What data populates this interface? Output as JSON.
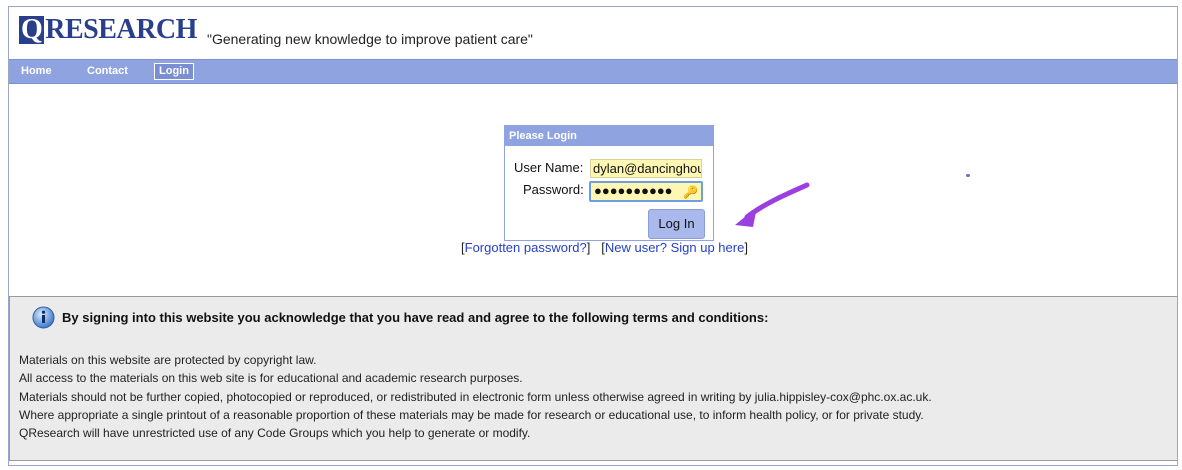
{
  "header": {
    "logo_letter": "Q",
    "logo_rest": "RESEARCH",
    "tagline": "\"Generating new knowledge to improve patient care\""
  },
  "nav": {
    "home": "Home",
    "contact": "Contact",
    "login": "Login"
  },
  "login_box": {
    "title": "Please Login",
    "user_label": "User Name:",
    "user_value": "dylan@dancinghou:",
    "password_label": "Password:",
    "password_value": "●●●●●●●●●●",
    "submit_label": "Log In"
  },
  "links": {
    "open1": "[",
    "forgot": "Forgotten password?",
    "close1": "]",
    "open2": "[",
    "signup": "New user? Sign up here",
    "close2": "]"
  },
  "terms": {
    "heading": "By signing into this website you acknowledge that you have read and agree to the following terms and conditions:",
    "lines": [
      "Materials on this website are protected by copyright law.",
      "All access to the materials on this web site is for educational and academic research purposes.",
      "Materials should not be further copied, photocopied or reproduced, or redistributed in electronic form unless otherwise agreed in writing by julia.hippisley-cox@phc.ox.ac.uk.",
      "Where appropriate a single printout of a reasonable proportion of these materials may be made for research or educational use, to inform health policy, or for private study.",
      "QResearch will have unrestricted use of any Code Groups which you help to generate or modify."
    ]
  },
  "colors": {
    "nav_bg": "#8fa3e0",
    "logo": "#2a3f8c",
    "input_bg": "#fdf7b3",
    "arrow": "#9b3fe0",
    "link": "#2540c8"
  }
}
